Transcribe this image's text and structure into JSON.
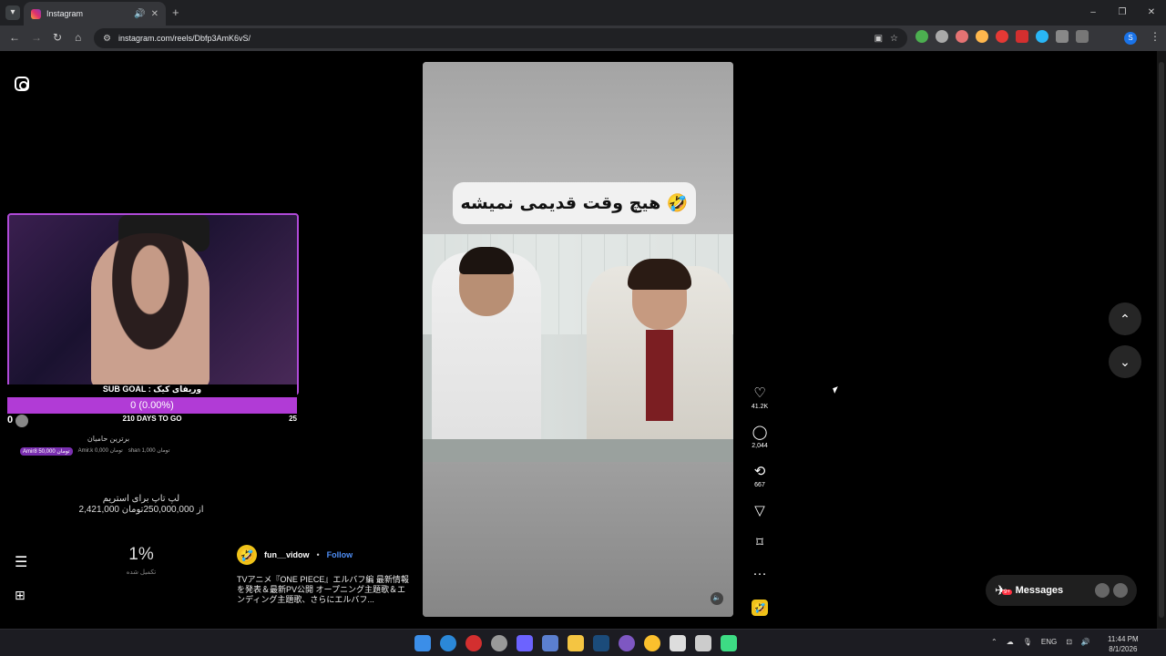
{
  "browser": {
    "tab_title": "Instagram",
    "url": "instagram.com/reels/Dbfp3AmK6vS/",
    "new_tab": "+",
    "tab_dropdown": "▾",
    "window": {
      "minimize": "–",
      "maximize": "❐",
      "close": "✕"
    }
  },
  "overlay": {
    "sub_goal_label": "SUB GOAL : وریفای کیک",
    "sub_goal_value": "0 (0.00%)",
    "sub_goal_left": "0",
    "days_to_go": "210 DAYS TO GO",
    "sub_goal_right": "25",
    "top_supporters_title": "برترین حامیان",
    "donors": [
      "Amir8 تومان 50,000",
      "Amir.k تومان 0,000",
      "shan تومان 1,000"
    ],
    "laptop_title": "لپ تاپ برای استریم",
    "laptop_progress": "2,421,000 از 250,000,000تومان",
    "percent": "1%",
    "percent_sub": "تکمیل شده"
  },
  "reel": {
    "caption": "هیچ وقت قدیمی نمیشه 🤣",
    "username": "fun__vidow",
    "separator": "•",
    "follow": "Follow",
    "description": "TVアニメ『ONE PIECE』エルバフ編 最新情報を発表＆最新PV公開 オープニング主題歌＆エンディング主題歌、さらにエルバフ...",
    "likes": "41.2K",
    "comments": "2,044",
    "reposts": "667",
    "mute_icon": "🔈",
    "more": "···"
  },
  "messages": {
    "label": "Messages",
    "badge": "9+"
  },
  "taskbar": {
    "lang": "ENG",
    "time": "11:44 PM",
    "date": "8/1/2026"
  },
  "colors": {
    "accent_purple": "#b13bd6",
    "follow_blue": "#4f8ff7",
    "badge_red": "#ff3040"
  }
}
